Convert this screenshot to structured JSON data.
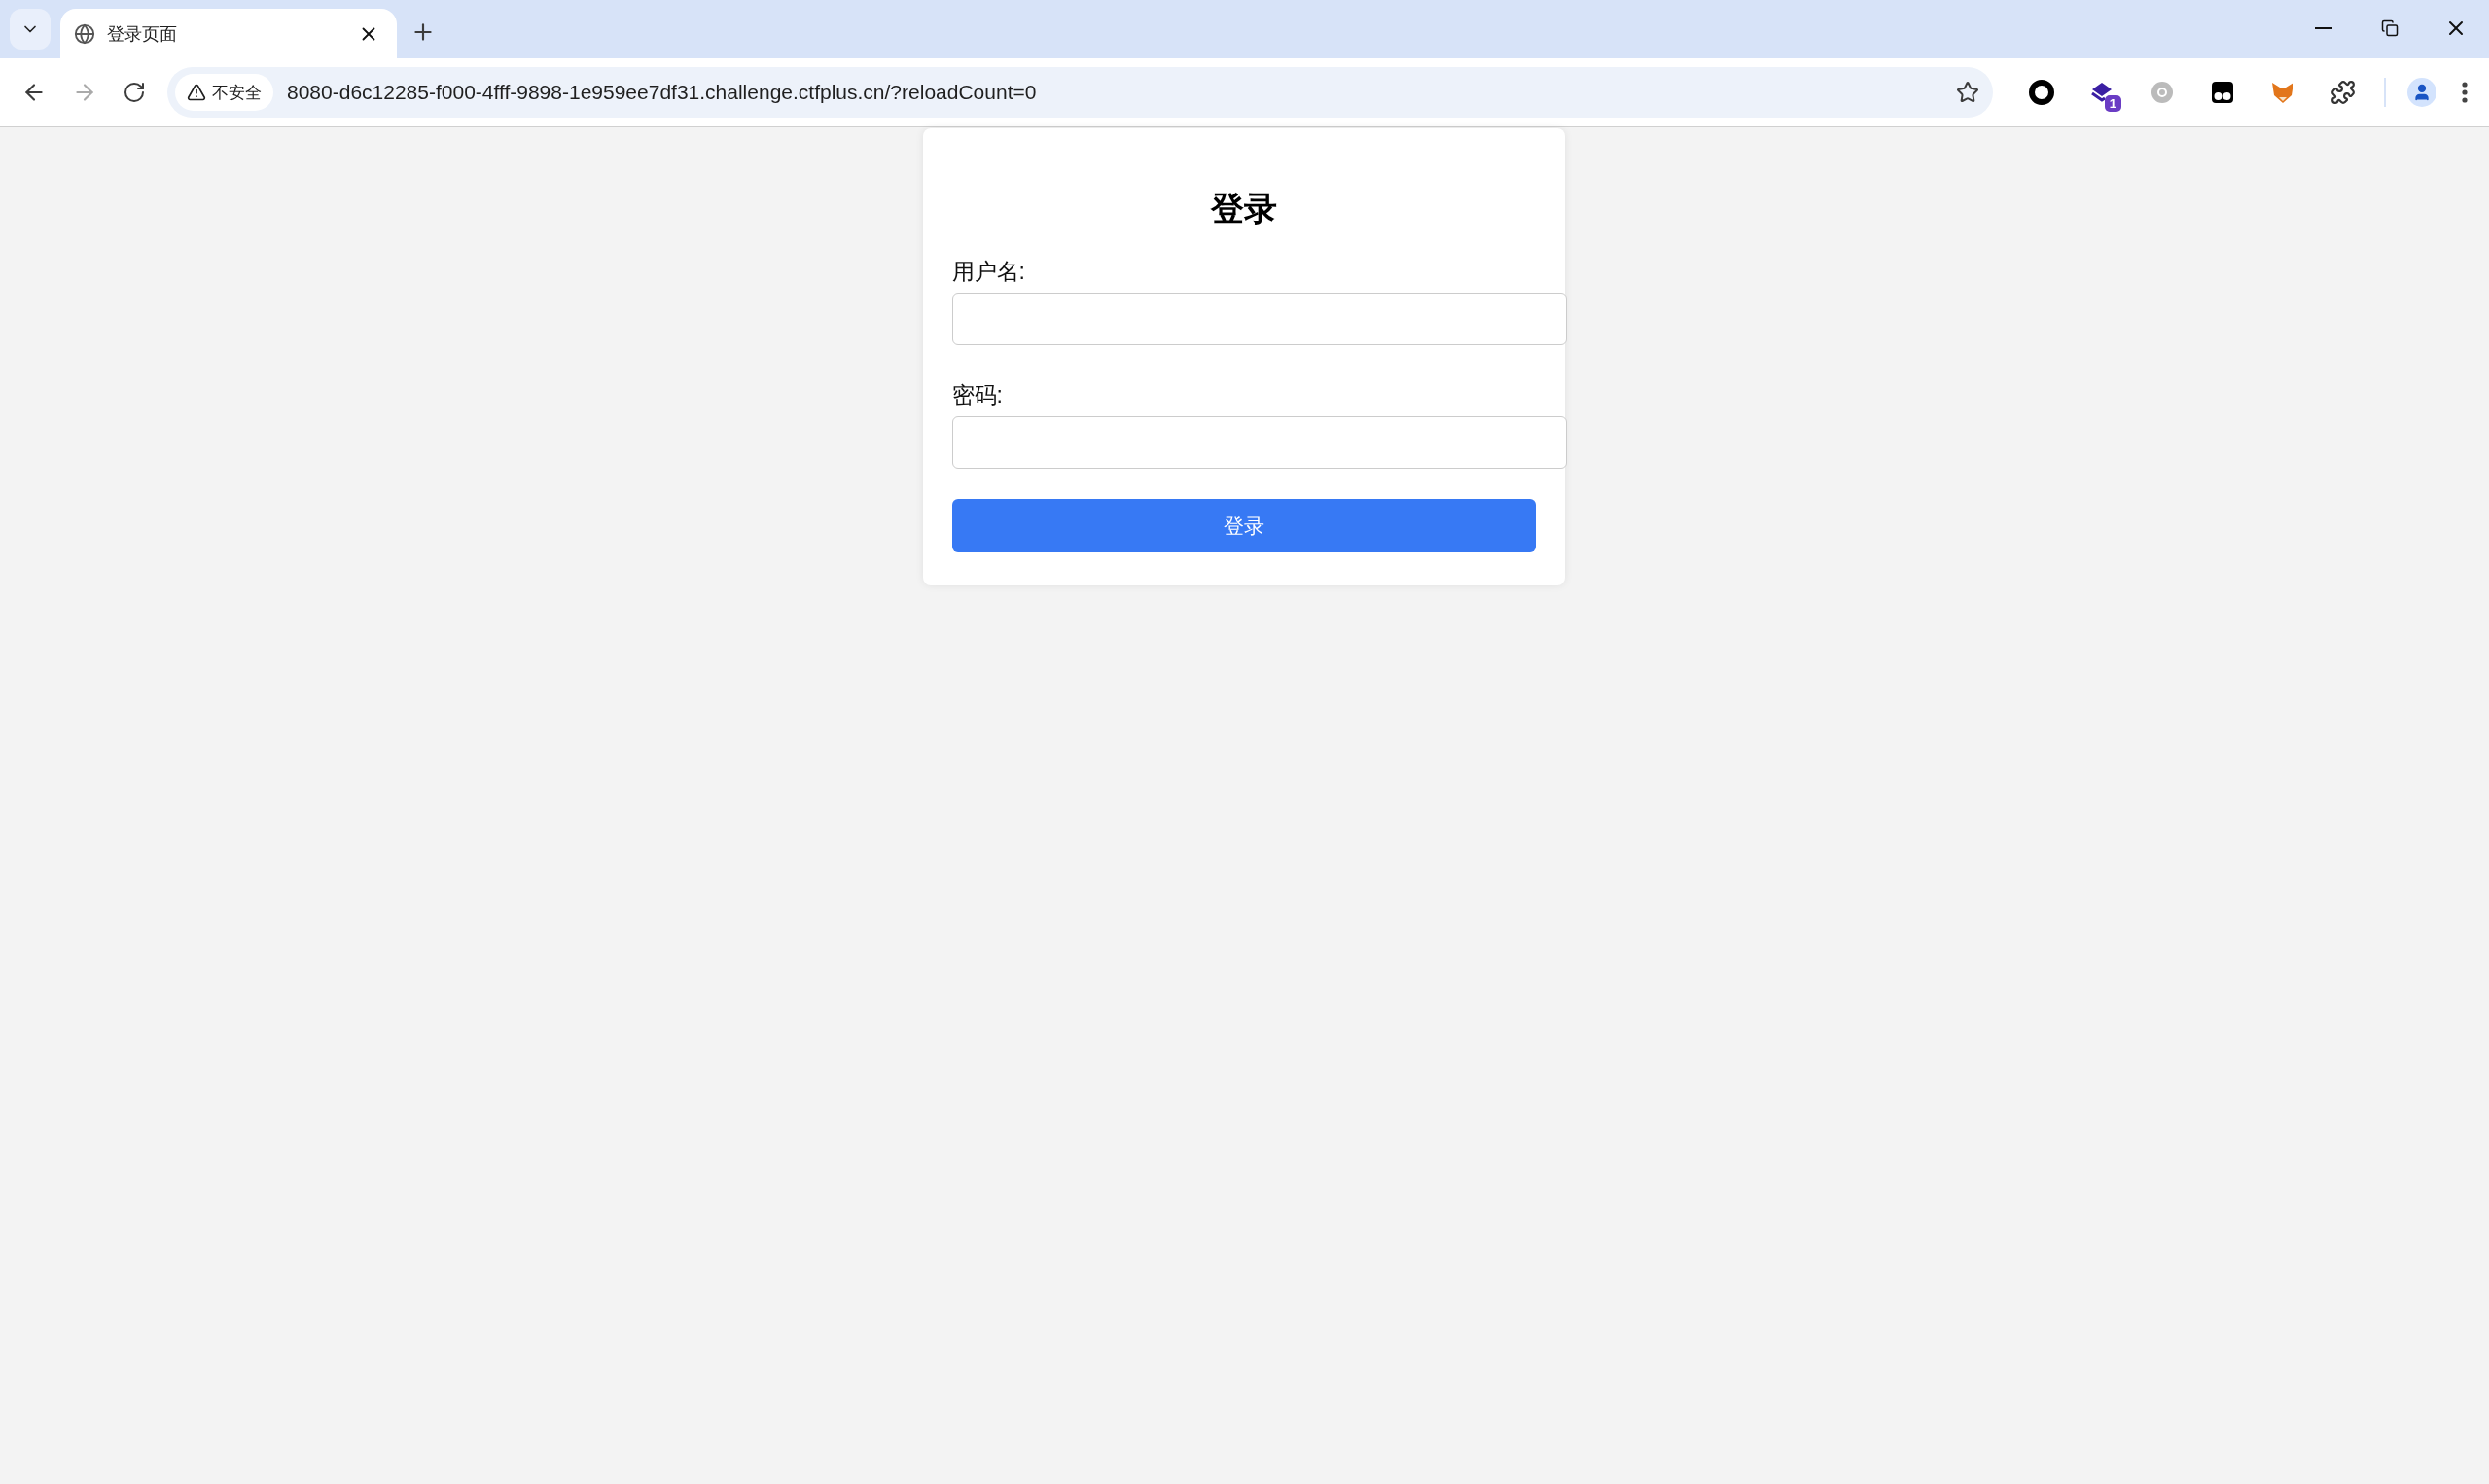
{
  "browser": {
    "tab": {
      "title": "登录页面",
      "selected": true
    },
    "address_bar": {
      "security_label": "不安全",
      "url": "8080-d6c12285-f000-4fff-9898-1e959ee7df31.challenge.ctfplus.cn/?reloadCount=0"
    },
    "extension_badge": "1"
  },
  "login_form": {
    "title": "登录",
    "fields": [
      {
        "label": "用户名:"
      },
      {
        "label": "密码:"
      }
    ],
    "submit_button": "登录"
  }
}
